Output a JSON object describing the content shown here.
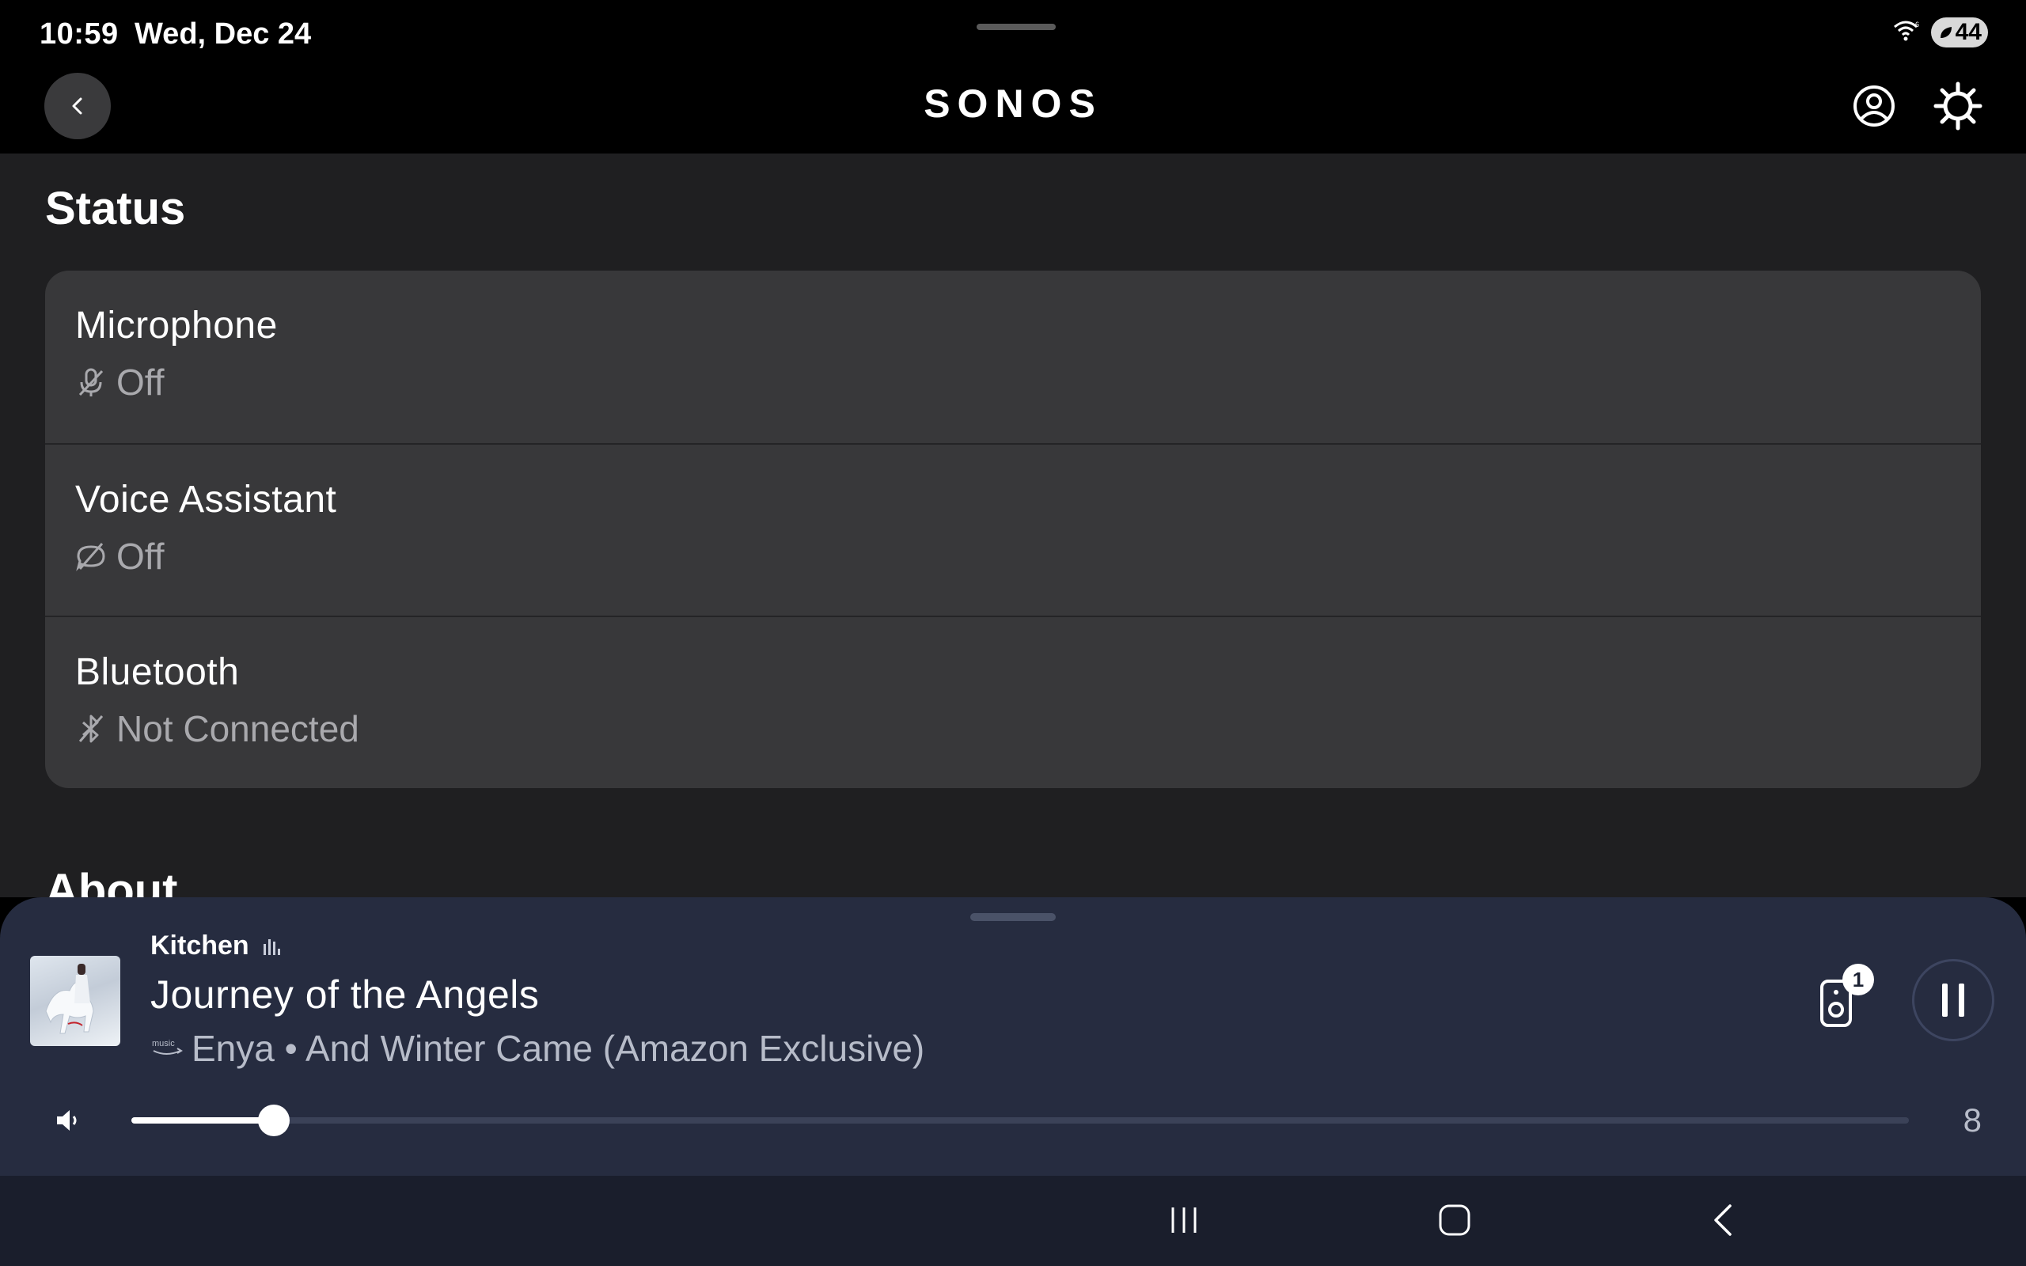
{
  "status_bar": {
    "time": "10:59",
    "date": "Wed, Dec 24",
    "battery": "44",
    "icons": [
      "wifi-icon",
      "battery-saver-icon"
    ]
  },
  "header": {
    "logo": "SONOS",
    "icons": [
      "back-icon",
      "account-icon",
      "settings-gear-icon"
    ]
  },
  "status_section": {
    "title": "Status",
    "rows": [
      {
        "label": "Microphone",
        "value": "Off",
        "icon": "microphone-off-icon"
      },
      {
        "label": "Voice Assistant",
        "value": "Off",
        "icon": "voice-off-icon"
      },
      {
        "label": "Bluetooth",
        "value": "Not Connected",
        "icon": "bluetooth-off-icon"
      }
    ]
  },
  "about_section": {
    "title": "About"
  },
  "now_playing": {
    "room": "Kitchen",
    "track": "Journey of the Angels",
    "service_icon": "amazon-music-icon",
    "artist_album": "Enya • And Winter Came (Amazon Exclusive)",
    "group_count": "1",
    "volume": "8",
    "volume_level_percent": 8,
    "colors": {
      "player_bg": "#262c40",
      "accent": "#ffffff"
    }
  },
  "nav_bar": {
    "icons": [
      "recents-icon",
      "home-icon",
      "back-icon"
    ]
  }
}
